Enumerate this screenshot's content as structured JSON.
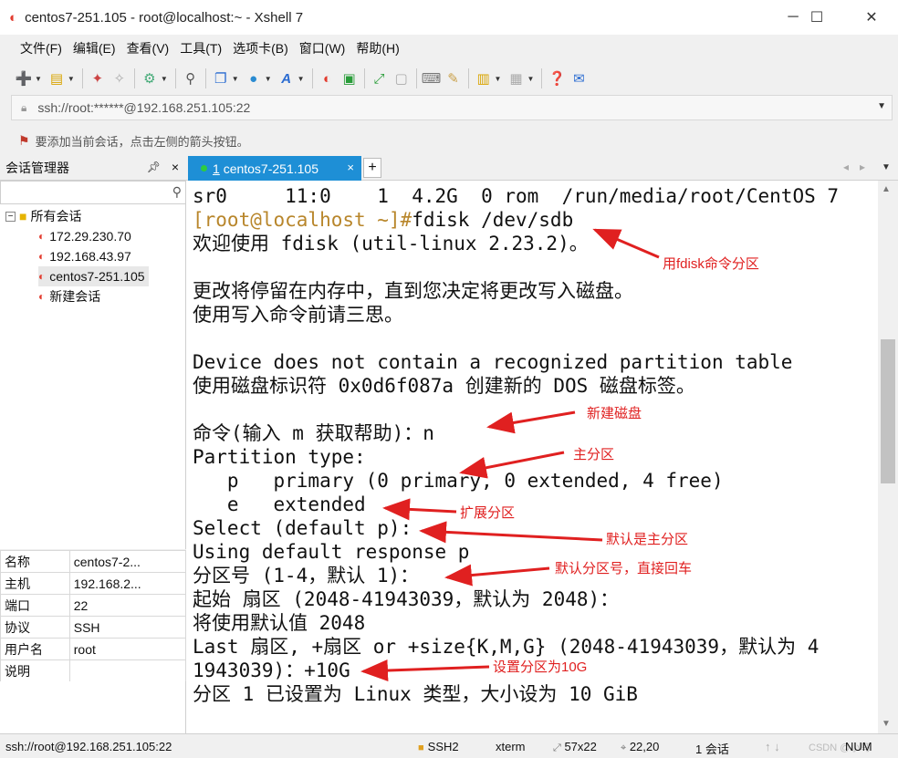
{
  "window": {
    "title": "centos7-251.105 - root@localhost:~ - Xshell 7"
  },
  "menu": {
    "items": [
      "文件(F)",
      "编辑(E)",
      "查看(V)",
      "工具(T)",
      "选项卡(B)",
      "窗口(W)",
      "帮助(H)"
    ]
  },
  "address": {
    "value": "ssh://root:******@192.168.251.105:22"
  },
  "hint": {
    "text": "要添加当前会话，点击左侧的箭头按钮。"
  },
  "sidebar": {
    "title": "会话管理器",
    "root": "所有会话",
    "sessions": [
      "172.29.230.70",
      "192.168.43.97",
      "centos7-251.105",
      "新建会话"
    ],
    "selected_index": 2
  },
  "properties": [
    {
      "key": "名称",
      "value": "centos7-2..."
    },
    {
      "key": "主机",
      "value": "192.168.2..."
    },
    {
      "key": "端口",
      "value": "22"
    },
    {
      "key": "协议",
      "value": "SSH"
    },
    {
      "key": "用户名",
      "value": "root"
    },
    {
      "key": "说明",
      "value": ""
    }
  ],
  "tab": {
    "number": "1",
    "label": "centos7-251.105"
  },
  "terminal": {
    "prompt": "[root@localhost ~]#",
    "command": "fdisk /dev/sdb",
    "lines": [
      "sr0     11:0    1  4.2G  0 rom  /run/media/root/CentOS 7",
      "",
      "欢迎使用 fdisk (util-linux 2.23.2)。",
      "",
      "更改将停留在内存中，直到您决定将更改写入磁盘。",
      "使用写入命令前请三思。",
      "",
      "Device does not contain a recognized partition table",
      "使用磁盘标识符 0x0d6f087a 创建新的 DOS 磁盘标签。",
      "",
      "命令(输入 m 获取帮助)：n",
      "Partition type:",
      "   p   primary (0 primary, 0 extended, 4 free)",
      "   e   extended",
      "Select (default p):",
      "Using default response p",
      "分区号 (1-4，默认 1)：",
      "起始 扇区 (2048-41943039，默认为 2048)：",
      "将使用默认值 2048",
      "Last 扇区, +扇区 or +size{K,M,G} (2048-41943039，默认为 4",
      "1943039)：+10G",
      "分区 1 已设置为 Linux 类型，大小设为 10 GiB"
    ]
  },
  "annotations": [
    "用fdisk命令分区",
    "新建磁盘",
    "主分区",
    "扩展分区",
    "默认是主分区",
    "默认分区号，直接回车",
    "设置分区为10G"
  ],
  "colors": {
    "annotation": "#e02020",
    "tab_active": "#1e8fd6",
    "prompt": "#b8862b"
  },
  "status": {
    "address": "ssh://root@192.168.251.105:22",
    "protocol": "SSH2",
    "term": "xterm",
    "size": "57x22",
    "cursor": "22,20",
    "sessions": "1 会话",
    "watermark": "CSDN @小鸟",
    "num": "NUM"
  }
}
